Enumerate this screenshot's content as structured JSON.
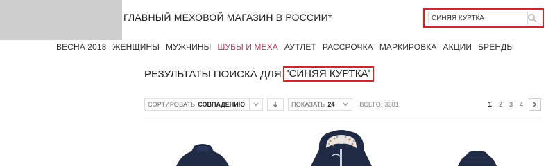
{
  "header": {
    "tagline": "ГЛАВНЫЙ МЕХОВОЙ МАГАЗИН В РОССИИ*",
    "search": {
      "value": "СИНЯЯ КУРТКА",
      "icon": "search-icon"
    }
  },
  "nav": {
    "items": [
      {
        "label": "ВЕСНА 2018"
      },
      {
        "label": "ЖЕНЩИНЫ"
      },
      {
        "label": "МУЖЧИНЫ"
      },
      {
        "label": "ШУБЫ И МЕХА",
        "active": true
      },
      {
        "label": "АУТЛЕТ"
      },
      {
        "label": "РАССРОЧКА"
      },
      {
        "label": "МАРКИРОВКА"
      },
      {
        "label": "АКЦИИ"
      },
      {
        "label": "БРЕНДЫ"
      }
    ],
    "active_color": "#b83a5a"
  },
  "results": {
    "title_prefix": "РЕЗУЛЬТАТЫ ПОИСКА ДЛЯ",
    "query": "'СИНЯЯ КУРТКА'"
  },
  "toolbar": {
    "sort_label": "СОРТИРОВАТЬ",
    "sort_value": "СОВПАДЕНИЮ",
    "sort_direction_icon": "arrow-down-icon",
    "show_label": "ПОКАЗАТЬ",
    "show_value": "24",
    "total": "ВСЕГО: 3381"
  },
  "pagination": {
    "pages": [
      "1",
      "2",
      "3",
      "4"
    ],
    "current": "1",
    "next_icon": "chevron-right-icon"
  },
  "colors": {
    "highlight": "#e02020",
    "jacket": "#1f2a44"
  }
}
